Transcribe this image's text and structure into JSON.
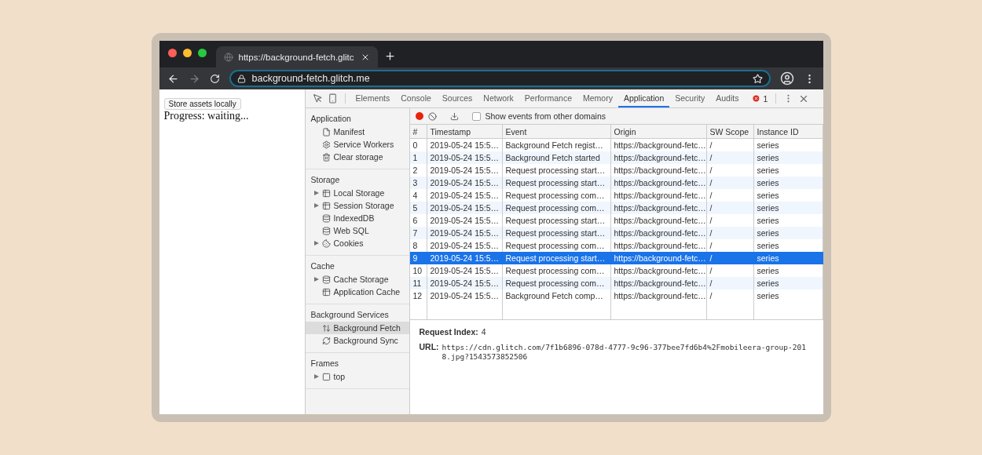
{
  "browser": {
    "tab_title": "https://background-fetch.glitc",
    "address": "background-fetch.glitch.me"
  },
  "page": {
    "button": "Store assets locally",
    "progress": "Progress: waiting..."
  },
  "devtools": {
    "tabs": [
      {
        "label": "Elements",
        "selected": false
      },
      {
        "label": "Console",
        "selected": false
      },
      {
        "label": "Sources",
        "selected": false
      },
      {
        "label": "Network",
        "selected": false
      },
      {
        "label": "Performance",
        "selected": false
      },
      {
        "label": "Memory",
        "selected": false
      },
      {
        "label": "Application",
        "selected": true
      },
      {
        "label": "Security",
        "selected": false
      },
      {
        "label": "Audits",
        "selected": false
      }
    ],
    "error_count": "1",
    "sidebar": [
      {
        "title": "Application",
        "items": [
          {
            "label": "Manifest",
            "kind": "file",
            "expandable": false,
            "selected": false
          },
          {
            "label": "Service Workers",
            "kind": "gear",
            "expandable": false,
            "selected": false
          },
          {
            "label": "Clear storage",
            "kind": "trash",
            "expandable": false,
            "selected": false
          }
        ]
      },
      {
        "title": "Storage",
        "items": [
          {
            "label": "Local Storage",
            "kind": "grid",
            "expandable": true,
            "selected": false
          },
          {
            "label": "Session Storage",
            "kind": "grid",
            "expandable": true,
            "selected": false
          },
          {
            "label": "IndexedDB",
            "kind": "db",
            "expandable": false,
            "selected": false
          },
          {
            "label": "Web SQL",
            "kind": "db",
            "expandable": false,
            "selected": false
          },
          {
            "label": "Cookies",
            "kind": "cookie",
            "expandable": true,
            "selected": false
          }
        ]
      },
      {
        "title": "Cache",
        "items": [
          {
            "label": "Cache Storage",
            "kind": "db",
            "expandable": true,
            "selected": false
          },
          {
            "label": "Application Cache",
            "kind": "grid",
            "expandable": false,
            "selected": false
          }
        ]
      },
      {
        "title": "Background Services",
        "items": [
          {
            "label": "Background Fetch",
            "kind": "updown",
            "expandable": false,
            "selected": true
          },
          {
            "label": "Background Sync",
            "kind": "sync",
            "expandable": false,
            "selected": false
          }
        ]
      },
      {
        "title": "Frames",
        "items": [
          {
            "label": "top",
            "kind": "frame",
            "expandable": true,
            "selected": false
          }
        ]
      }
    ],
    "toolbar": {
      "recording": true,
      "checkbox_label": "Show events from other domains",
      "checked": false
    },
    "table": {
      "columns": [
        "#",
        "Timestamp",
        "Event",
        "Origin",
        "SW Scope",
        "Instance ID"
      ],
      "rows": [
        {
          "cells": [
            "0",
            "2019-05-24 15:5…",
            "Background Fetch regist…",
            "https://background-fetc…",
            "/",
            "series"
          ],
          "selected": false
        },
        {
          "cells": [
            "1",
            "2019-05-24 15:5…",
            "Background Fetch started",
            "https://background-fetc…",
            "/",
            "series"
          ],
          "selected": false
        },
        {
          "cells": [
            "2",
            "2019-05-24 15:5…",
            "Request processing start…",
            "https://background-fetc…",
            "/",
            "series"
          ],
          "selected": false
        },
        {
          "cells": [
            "3",
            "2019-05-24 15:5…",
            "Request processing start…",
            "https://background-fetc…",
            "/",
            "series"
          ],
          "selected": false
        },
        {
          "cells": [
            "4",
            "2019-05-24 15:5…",
            "Request processing com…",
            "https://background-fetc…",
            "/",
            "series"
          ],
          "selected": false
        },
        {
          "cells": [
            "5",
            "2019-05-24 15:5…",
            "Request processing com…",
            "https://background-fetc…",
            "/",
            "series"
          ],
          "selected": false
        },
        {
          "cells": [
            "6",
            "2019-05-24 15:5…",
            "Request processing start…",
            "https://background-fetc…",
            "/",
            "series"
          ],
          "selected": false
        },
        {
          "cells": [
            "7",
            "2019-05-24 15:5…",
            "Request processing start…",
            "https://background-fetc…",
            "/",
            "series"
          ],
          "selected": false
        },
        {
          "cells": [
            "8",
            "2019-05-24 15:5…",
            "Request processing com…",
            "https://background-fetc…",
            "/",
            "series"
          ],
          "selected": false
        },
        {
          "cells": [
            "9",
            "2019-05-24 15:5…",
            "Request processing start…",
            "https://background-fetc…",
            "/",
            "series"
          ],
          "selected": true
        },
        {
          "cells": [
            "10",
            "2019-05-24 15:5…",
            "Request processing com…",
            "https://background-fetc…",
            "/",
            "series"
          ],
          "selected": false
        },
        {
          "cells": [
            "11",
            "2019-05-24 15:5…",
            "Request processing com…",
            "https://background-fetc…",
            "/",
            "series"
          ],
          "selected": false
        },
        {
          "cells": [
            "12",
            "2019-05-24 15:5…",
            "Background Fetch comp…",
            "https://background-fetc…",
            "/",
            "series"
          ],
          "selected": false
        }
      ]
    },
    "details": [
      {
        "label": "Request Index:",
        "value": "4",
        "kind": "text"
      },
      {
        "label": "URL:",
        "value": "https://cdn.glitch.com/7f1b6896-078d-4777-9c96-377bee7fd6b4%2Fmobileera-group-2018.jpg?1543573852506",
        "kind": "code"
      }
    ]
  }
}
